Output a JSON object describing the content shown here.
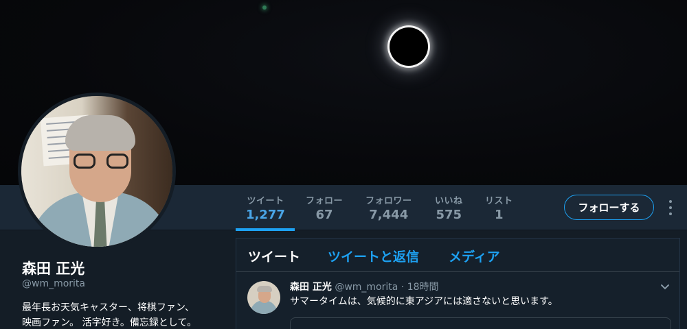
{
  "profile": {
    "name": "森田 正光",
    "handle": "@wm_morita",
    "bio_line1": "最年長お天気キャスター、将棋ファン、",
    "bio_line2": "映画ファン。 活字好き。備忘録として。"
  },
  "stats": [
    {
      "label": "ツイート",
      "value": "1,277"
    },
    {
      "label": "フォロー",
      "value": "67"
    },
    {
      "label": "フォロワー",
      "value": "7,444"
    },
    {
      "label": "いいね",
      "value": "575"
    },
    {
      "label": "リスト",
      "value": "1"
    }
  ],
  "follow_button": "フォローする",
  "timeline": {
    "tabs": [
      "ツイート",
      "ツイートと返信",
      "メディア"
    ],
    "tweet": {
      "name": "森田 正光",
      "handle": "@wm_morita",
      "separator": "·",
      "time": "18時間",
      "text": "サマータイムは、気候的に東アジアには適さないと思います。"
    }
  },
  "colors": {
    "accent": "#1da1f2",
    "background": "#141d26",
    "navbar": "#1b2836",
    "muted_text": "#8899a6"
  },
  "icons": {
    "more": "vertical-ellipsis-icon",
    "tweet_menu": "chevron-down-icon"
  }
}
